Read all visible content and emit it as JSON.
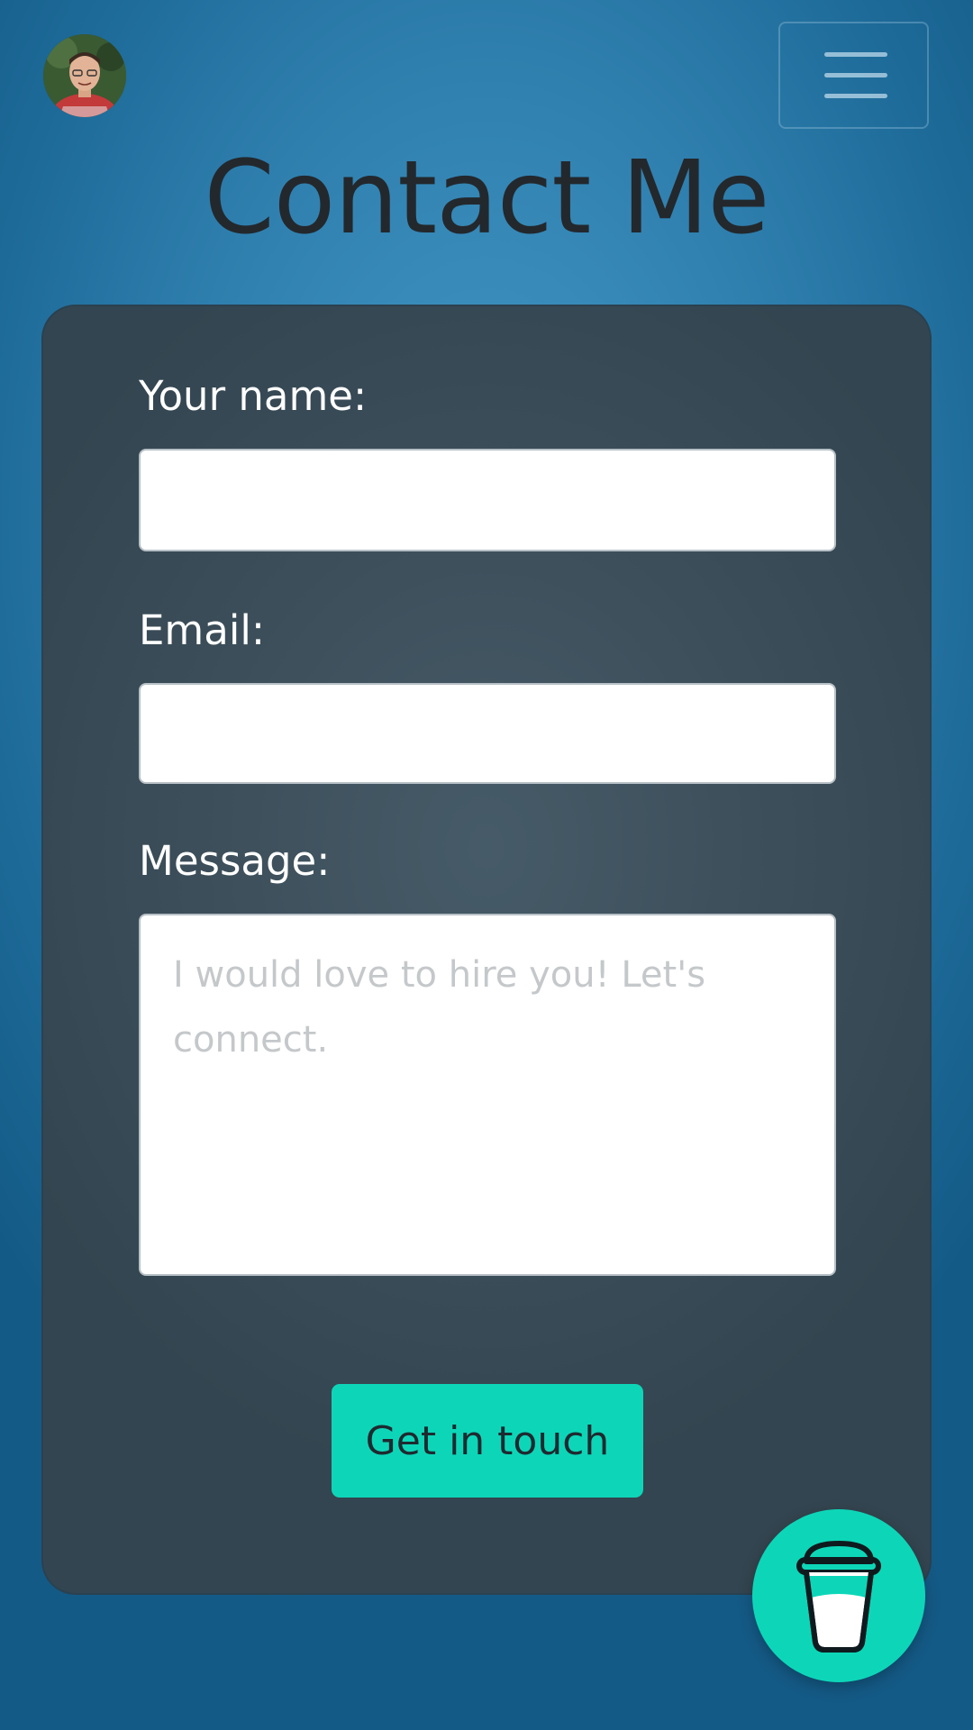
{
  "header": {
    "title": "Contact Me",
    "avatar_icon": "profile-photo",
    "menu_icon": "hamburger-icon"
  },
  "form": {
    "name_label": "Your name:",
    "name_value": "",
    "email_label": "Email:",
    "email_value": "",
    "message_label": "Message:",
    "message_value": "",
    "message_placeholder": "I would love to hire you! Let's connect.",
    "submit_label": "Get in touch"
  },
  "fab": {
    "icon": "coffee-cup-icon"
  },
  "colors": {
    "accent": "#0dd6b8",
    "card": "#3e505c",
    "title": "#23282d",
    "background": "#2f7fae"
  }
}
